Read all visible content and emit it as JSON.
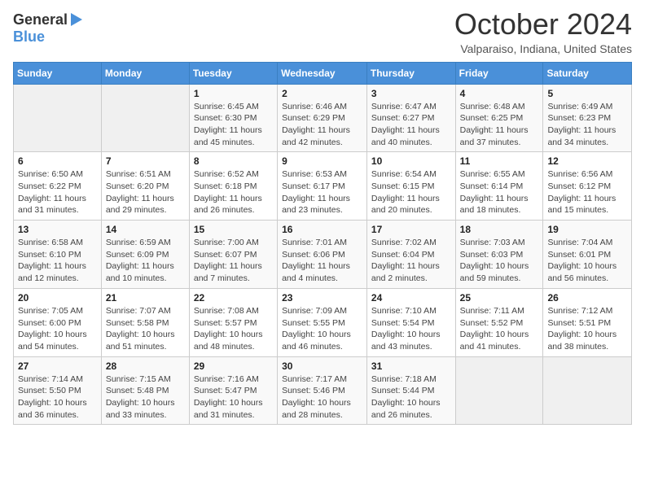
{
  "logo": {
    "general": "General",
    "blue": "Blue"
  },
  "title": "October 2024",
  "subtitle": "Valparaiso, Indiana, United States",
  "days_of_week": [
    "Sunday",
    "Monday",
    "Tuesday",
    "Wednesday",
    "Thursday",
    "Friday",
    "Saturday"
  ],
  "weeks": [
    [
      {
        "day": null,
        "sunrise": null,
        "sunset": null,
        "daylight": null
      },
      {
        "day": null,
        "sunrise": null,
        "sunset": null,
        "daylight": null
      },
      {
        "day": "1",
        "sunrise": "Sunrise: 6:45 AM",
        "sunset": "Sunset: 6:30 PM",
        "daylight": "Daylight: 11 hours and 45 minutes."
      },
      {
        "day": "2",
        "sunrise": "Sunrise: 6:46 AM",
        "sunset": "Sunset: 6:29 PM",
        "daylight": "Daylight: 11 hours and 42 minutes."
      },
      {
        "day": "3",
        "sunrise": "Sunrise: 6:47 AM",
        "sunset": "Sunset: 6:27 PM",
        "daylight": "Daylight: 11 hours and 40 minutes."
      },
      {
        "day": "4",
        "sunrise": "Sunrise: 6:48 AM",
        "sunset": "Sunset: 6:25 PM",
        "daylight": "Daylight: 11 hours and 37 minutes."
      },
      {
        "day": "5",
        "sunrise": "Sunrise: 6:49 AM",
        "sunset": "Sunset: 6:23 PM",
        "daylight": "Daylight: 11 hours and 34 minutes."
      }
    ],
    [
      {
        "day": "6",
        "sunrise": "Sunrise: 6:50 AM",
        "sunset": "Sunset: 6:22 PM",
        "daylight": "Daylight: 11 hours and 31 minutes."
      },
      {
        "day": "7",
        "sunrise": "Sunrise: 6:51 AM",
        "sunset": "Sunset: 6:20 PM",
        "daylight": "Daylight: 11 hours and 29 minutes."
      },
      {
        "day": "8",
        "sunrise": "Sunrise: 6:52 AM",
        "sunset": "Sunset: 6:18 PM",
        "daylight": "Daylight: 11 hours and 26 minutes."
      },
      {
        "day": "9",
        "sunrise": "Sunrise: 6:53 AM",
        "sunset": "Sunset: 6:17 PM",
        "daylight": "Daylight: 11 hours and 23 minutes."
      },
      {
        "day": "10",
        "sunrise": "Sunrise: 6:54 AM",
        "sunset": "Sunset: 6:15 PM",
        "daylight": "Daylight: 11 hours and 20 minutes."
      },
      {
        "day": "11",
        "sunrise": "Sunrise: 6:55 AM",
        "sunset": "Sunset: 6:14 PM",
        "daylight": "Daylight: 11 hours and 18 minutes."
      },
      {
        "day": "12",
        "sunrise": "Sunrise: 6:56 AM",
        "sunset": "Sunset: 6:12 PM",
        "daylight": "Daylight: 11 hours and 15 minutes."
      }
    ],
    [
      {
        "day": "13",
        "sunrise": "Sunrise: 6:58 AM",
        "sunset": "Sunset: 6:10 PM",
        "daylight": "Daylight: 11 hours and 12 minutes."
      },
      {
        "day": "14",
        "sunrise": "Sunrise: 6:59 AM",
        "sunset": "Sunset: 6:09 PM",
        "daylight": "Daylight: 11 hours and 10 minutes."
      },
      {
        "day": "15",
        "sunrise": "Sunrise: 7:00 AM",
        "sunset": "Sunset: 6:07 PM",
        "daylight": "Daylight: 11 hours and 7 minutes."
      },
      {
        "day": "16",
        "sunrise": "Sunrise: 7:01 AM",
        "sunset": "Sunset: 6:06 PM",
        "daylight": "Daylight: 11 hours and 4 minutes."
      },
      {
        "day": "17",
        "sunrise": "Sunrise: 7:02 AM",
        "sunset": "Sunset: 6:04 PM",
        "daylight": "Daylight: 11 hours and 2 minutes."
      },
      {
        "day": "18",
        "sunrise": "Sunrise: 7:03 AM",
        "sunset": "Sunset: 6:03 PM",
        "daylight": "Daylight: 10 hours and 59 minutes."
      },
      {
        "day": "19",
        "sunrise": "Sunrise: 7:04 AM",
        "sunset": "Sunset: 6:01 PM",
        "daylight": "Daylight: 10 hours and 56 minutes."
      }
    ],
    [
      {
        "day": "20",
        "sunrise": "Sunrise: 7:05 AM",
        "sunset": "Sunset: 6:00 PM",
        "daylight": "Daylight: 10 hours and 54 minutes."
      },
      {
        "day": "21",
        "sunrise": "Sunrise: 7:07 AM",
        "sunset": "Sunset: 5:58 PM",
        "daylight": "Daylight: 10 hours and 51 minutes."
      },
      {
        "day": "22",
        "sunrise": "Sunrise: 7:08 AM",
        "sunset": "Sunset: 5:57 PM",
        "daylight": "Daylight: 10 hours and 48 minutes."
      },
      {
        "day": "23",
        "sunrise": "Sunrise: 7:09 AM",
        "sunset": "Sunset: 5:55 PM",
        "daylight": "Daylight: 10 hours and 46 minutes."
      },
      {
        "day": "24",
        "sunrise": "Sunrise: 7:10 AM",
        "sunset": "Sunset: 5:54 PM",
        "daylight": "Daylight: 10 hours and 43 minutes."
      },
      {
        "day": "25",
        "sunrise": "Sunrise: 7:11 AM",
        "sunset": "Sunset: 5:52 PM",
        "daylight": "Daylight: 10 hours and 41 minutes."
      },
      {
        "day": "26",
        "sunrise": "Sunrise: 7:12 AM",
        "sunset": "Sunset: 5:51 PM",
        "daylight": "Daylight: 10 hours and 38 minutes."
      }
    ],
    [
      {
        "day": "27",
        "sunrise": "Sunrise: 7:14 AM",
        "sunset": "Sunset: 5:50 PM",
        "daylight": "Daylight: 10 hours and 36 minutes."
      },
      {
        "day": "28",
        "sunrise": "Sunrise: 7:15 AM",
        "sunset": "Sunset: 5:48 PM",
        "daylight": "Daylight: 10 hours and 33 minutes."
      },
      {
        "day": "29",
        "sunrise": "Sunrise: 7:16 AM",
        "sunset": "Sunset: 5:47 PM",
        "daylight": "Daylight: 10 hours and 31 minutes."
      },
      {
        "day": "30",
        "sunrise": "Sunrise: 7:17 AM",
        "sunset": "Sunset: 5:46 PM",
        "daylight": "Daylight: 10 hours and 28 minutes."
      },
      {
        "day": "31",
        "sunrise": "Sunrise: 7:18 AM",
        "sunset": "Sunset: 5:44 PM",
        "daylight": "Daylight: 10 hours and 26 minutes."
      },
      {
        "day": null,
        "sunrise": null,
        "sunset": null,
        "daylight": null
      },
      {
        "day": null,
        "sunrise": null,
        "sunset": null,
        "daylight": null
      }
    ]
  ]
}
